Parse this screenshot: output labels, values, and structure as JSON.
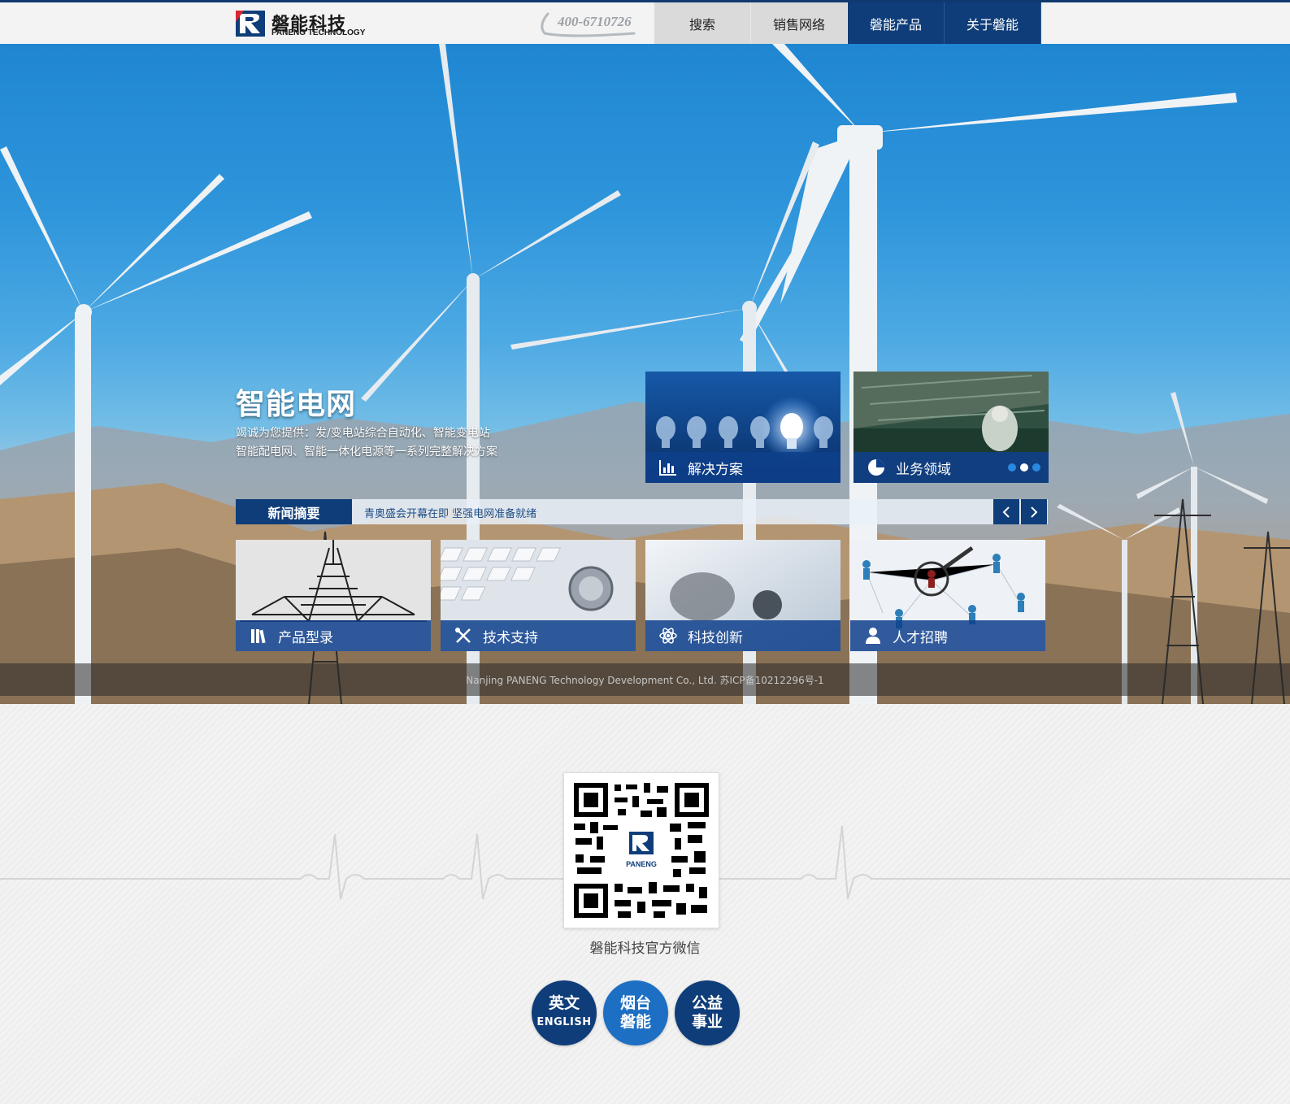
{
  "header": {
    "logo_cn": "磐能科技",
    "logo_en": "PANENG TECHNOLOGY",
    "phone": "400-6710726",
    "nav": [
      {
        "label": "搜索"
      },
      {
        "label": "销售网络"
      },
      {
        "label": "磐能产品"
      },
      {
        "label": "关于磐能"
      }
    ]
  },
  "hero": {
    "title": "智能电网",
    "line1": "竭诚为您提供：发/变电站综合自动化、智能变电站",
    "line2": "智能配电网、智能一体化电源等一系列完整解决方案",
    "feature_cards": [
      {
        "label": "解决方案",
        "icon": "bar-chart-icon"
      },
      {
        "label": "业务领域",
        "icon": "pie-chart-icon"
      }
    ],
    "carousel_dots": {
      "count": 3,
      "active_index": 1
    },
    "news": {
      "label": "新闻摘要",
      "headline": "青奥盛会开幕在即 坚强电网准备就绪"
    },
    "tiles": [
      {
        "label": "产品型录",
        "icon": "books-icon"
      },
      {
        "label": "技术支持",
        "icon": "tools-icon"
      },
      {
        "label": "科技创新",
        "icon": "atom-icon"
      },
      {
        "label": "人才招聘",
        "icon": "person-icon"
      }
    ],
    "footer": "Nanjing PANENG Technology Development Co., Ltd. 苏ICP备10212296号-1"
  },
  "lower": {
    "qr_logo": "PANENG",
    "qr_caption": "磐能科技官方微信",
    "buttons": [
      {
        "line1": "英文",
        "line2": "ENGLISH"
      },
      {
        "line1": "烟台",
        "line2": "磐能"
      },
      {
        "line1": "公益",
        "line2": "事业"
      }
    ]
  },
  "colors": {
    "brand_navy": "#0f3d79",
    "brand_blue": "#1d6fc3",
    "overlay_blue": "#0e408c"
  }
}
